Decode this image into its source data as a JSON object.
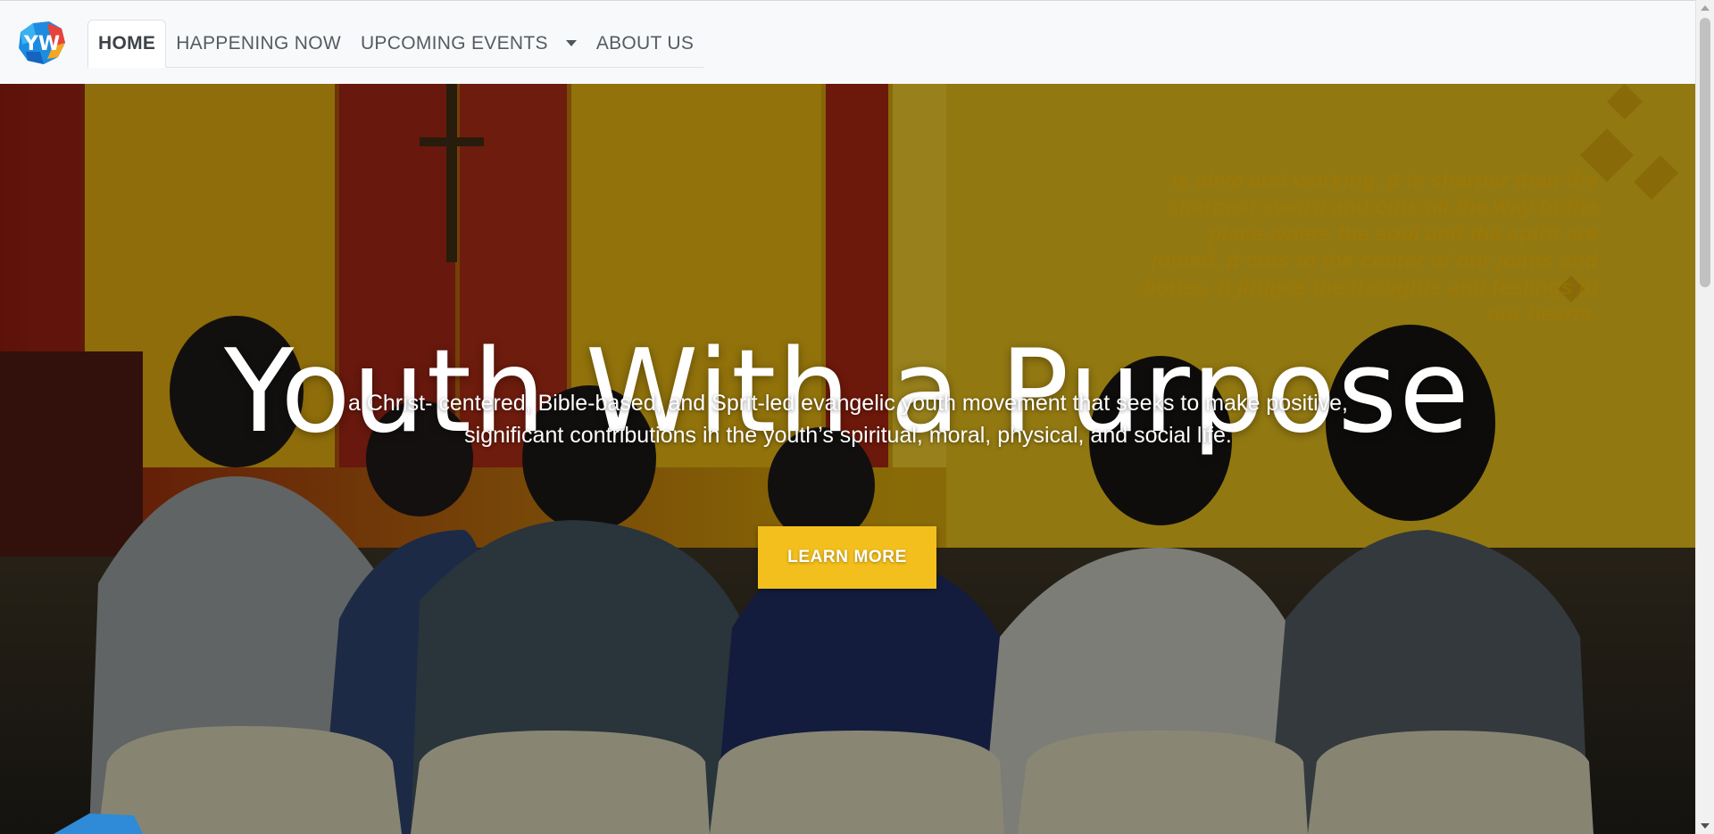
{
  "navbar": {
    "logo_icon": "ywap-logo-icon",
    "items": [
      {
        "label": "HOME",
        "active": true
      },
      {
        "label": "HAPPENING NOW",
        "active": false
      },
      {
        "label": "UPCOMING EVENTS",
        "active": false,
        "dropdown": true
      },
      {
        "label": "ABOUT US",
        "active": false
      }
    ]
  },
  "hero": {
    "title": "Youth With a Purpose",
    "subtitle_line1": "a Christ- centered, Bible-based, and Sprit-led evangelic youth movement that seeks to make positive,",
    "subtitle_line2": "significant contributions in the youth’s spiritual, moral, physical, and social life.",
    "button_label": "LEARN MORE",
    "background_verse": "is alive and working. It is sharper than the sharpest sword and cuts all the way to the place where the soul and the spirit are joined. It cuts to the center of our joints and bones. It judges the thoughts and feelings in our hearts.",
    "colors": {
      "accent": "#f3bf1c",
      "overlay_tint": "#c89a0a"
    }
  }
}
